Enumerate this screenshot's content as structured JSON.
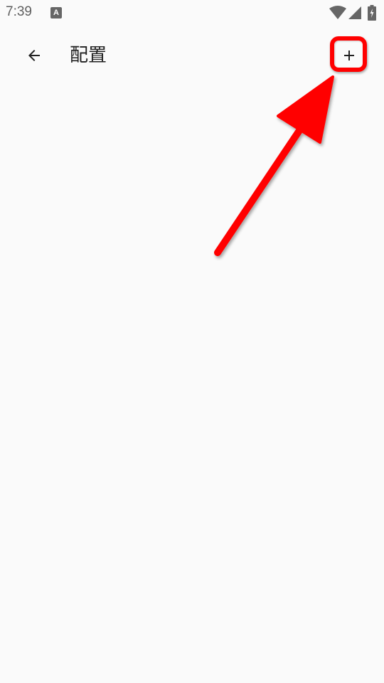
{
  "status_bar": {
    "time": "7:39",
    "notification_icon_letter": "A"
  },
  "app_bar": {
    "title": "配置",
    "back_icon": "arrow-back-icon",
    "add_icon": "plus-icon"
  },
  "annotation": {
    "color": "#ff0000"
  }
}
